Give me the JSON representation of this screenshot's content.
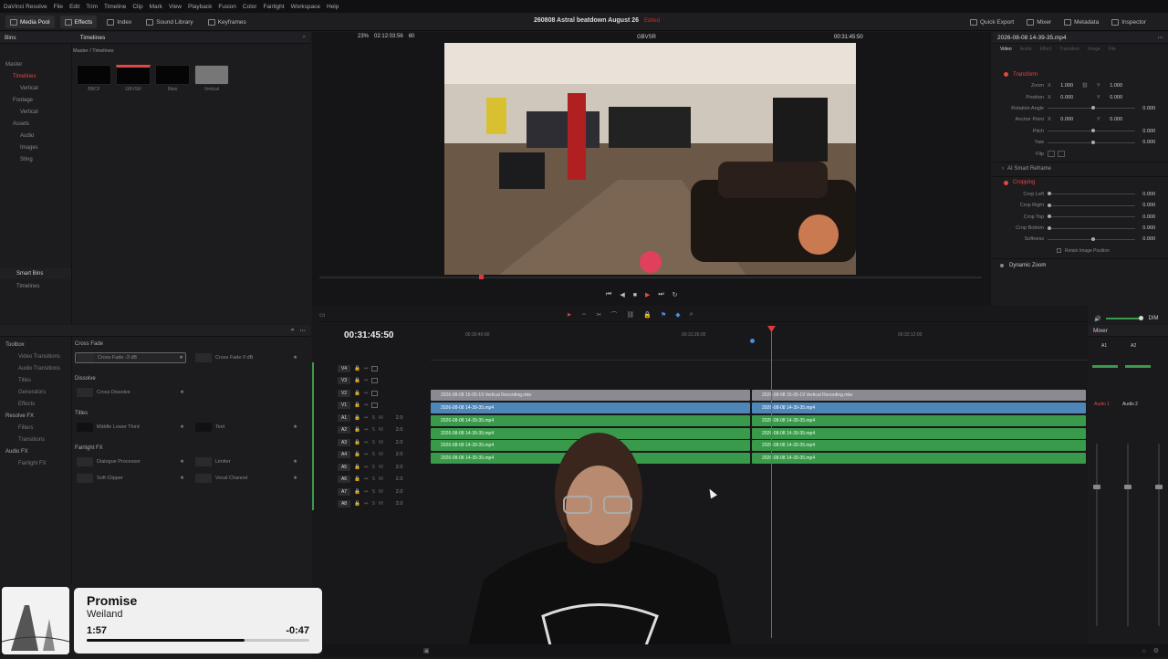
{
  "menubar": {
    "items": [
      "DaVinci Resolve",
      "File",
      "Edit",
      "Trim",
      "Timeline",
      "Clip",
      "Mark",
      "View",
      "Playback",
      "Fusion",
      "Color",
      "Fairlight",
      "Workspace",
      "Help"
    ]
  },
  "toolbar": {
    "media_pool": "Media Pool",
    "effects": "Effects",
    "index": "Index",
    "sound_library": "Sound Library",
    "keyframes": "Keyframes",
    "project_title": "260808 Astral beatdown August 26",
    "project_status": "Edited",
    "quick_export": "Quick Export",
    "mixer": "Mixer",
    "metadata": "Metadata",
    "inspector": "Inspector"
  },
  "media_pool": {
    "header": "Bins",
    "path": "Master / Timelines",
    "timeline_tab": "Timelines",
    "tree": [
      "Master",
      "Timelines",
      "Vertical",
      "Footage",
      "Vertical",
      "Assets",
      "Audio",
      "Images",
      "Sting"
    ],
    "smart_bins_label": "Smart Bins",
    "smart_bins": [
      "Timelines"
    ],
    "thumbnails": [
      "BBCF",
      "GBVSR",
      "Main",
      "Vertical"
    ]
  },
  "viewer": {
    "zoom": "23%",
    "source_tc": "02:12:03:56",
    "fps": "60",
    "clip_name": "GBVSR",
    "timecode": "00:31:45:50"
  },
  "inspector": {
    "clip_title": "2026-08-08 14-39-35.mp4",
    "tabs": [
      "Video",
      "Audio",
      "Effect",
      "Transition",
      "Image",
      "File"
    ],
    "transform_label": "Transform",
    "zoom_label": "Zoom",
    "zoom_x": "1.000",
    "zoom_y": "1.000",
    "position_label": "Position",
    "pos_x": "0.000",
    "pos_y": "0.000",
    "rotation_label": "Rotation Angle",
    "rotation": "0.000",
    "anchor_label": "Anchor Point",
    "anchor_x": "0.000",
    "anchor_y": "0.000",
    "pitch_label": "Pitch",
    "pitch": "0.000",
    "yaw_label": "Yaw",
    "yaw": "0.000",
    "flip_label": "Flip",
    "smart_reframe": "AI Smart Reframe",
    "cropping_label": "Cropping",
    "crop_left_label": "Crop Left",
    "crop_left": "0.000",
    "crop_right_label": "Crop Right",
    "crop_right": "0.000",
    "crop_top_label": "Crop Top",
    "crop_top": "0.000",
    "crop_bottom_label": "Crop Bottom",
    "crop_bottom": "0.000",
    "softness_label": "Softness",
    "softness": "0.000",
    "retain_label": "Retain Image Position",
    "dynamic_zoom_label": "Dynamic Zoom"
  },
  "effects": {
    "tree": [
      "Toolbox",
      "Video Transitions",
      "Audio Transitions",
      "Titles",
      "Generators",
      "Effects",
      "Resolve FX",
      "Filters",
      "Transitions",
      "Audio FX",
      "Fairlight FX"
    ],
    "cross_fade_label": "Cross Fade",
    "cross_fade_items": [
      "Cross Fade -3 dB",
      "Cross Fade 0 dB"
    ],
    "dissolve_label": "Dissolve",
    "dissolve_items": [
      "Cross Dissolve"
    ],
    "titles_label": "Titles",
    "titles_items": [
      "Middle Lower Third",
      "Text"
    ],
    "fairlight_label": "Fairlight FX",
    "fairlight_items": [
      "Dialogue Processor",
      "Limiter",
      "Soft Clipper",
      "Vocal Channel"
    ]
  },
  "timeline": {
    "timecode": "00:31:45:50",
    "ruler": [
      "00:30:40:00",
      "00:31:26:00",
      "00:32:12:00"
    ],
    "video_tracks": [
      "V4",
      "V3",
      "V2",
      "V1"
    ],
    "audio_tracks": [
      "A1",
      "A2",
      "A3",
      "A4",
      "A5",
      "A6",
      "A7",
      "A8"
    ],
    "audio_levels": [
      "2.0",
      "2.0",
      "2.0",
      "2.0",
      "2.0",
      "2.0",
      "2.0",
      "2.0"
    ],
    "v2_clip": "2026-08-08 15-05-19 Vertical Recording.mkv",
    "v1_clip": "2026-08-08 14-39-35.mp4",
    "a_clip": "2026-08-08 14-39-35.mp4"
  },
  "mixer": {
    "title": "Mixer",
    "channels": [
      "A1",
      "A2"
    ],
    "bus": [
      "Audio 1",
      "Audio 2"
    ],
    "dim": "DIM"
  },
  "now_playing": {
    "title": "Promise",
    "artist": "Weiland",
    "elapsed": "1:57",
    "remaining": "-0:47",
    "progress": 0.71
  },
  "colors": {
    "accent_red": "#e04848",
    "clip_blue": "#4f86b8",
    "clip_green": "#3a9a4c",
    "playhead": "#e0383a"
  }
}
